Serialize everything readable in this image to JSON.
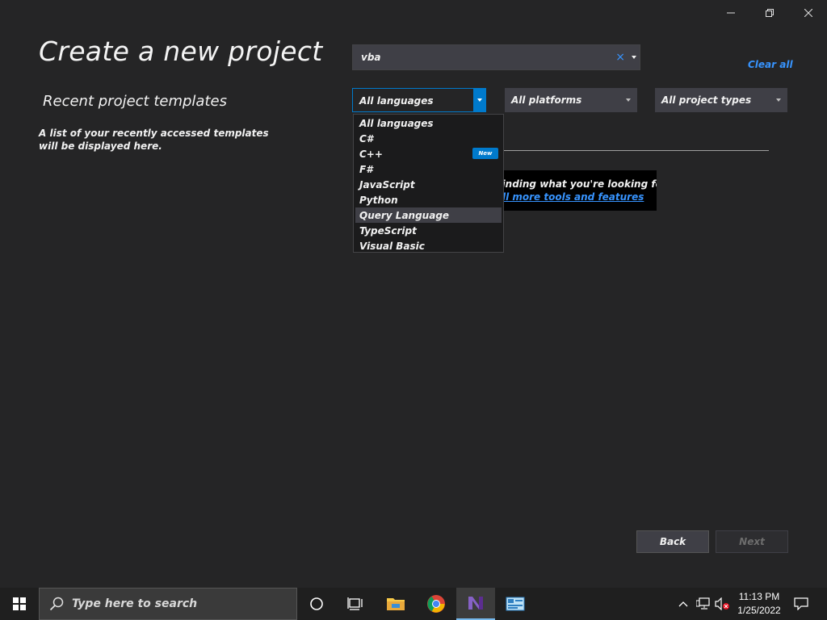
{
  "window": {
    "controls": [
      "minimize-icon",
      "restore-icon",
      "close-icon"
    ]
  },
  "page": {
    "title": "Create a new project",
    "recent_heading": "Recent project templates",
    "recent_description": "A list of your recently accessed templates will be displayed here."
  },
  "search": {
    "value": "vba",
    "clear_glyph": "×"
  },
  "clear_all_label": "Clear all",
  "filters": {
    "language": "All languages",
    "platform": "All platforms",
    "project_type": "All project types"
  },
  "language_dropdown": {
    "items": [
      "All languages",
      "C#",
      "C++",
      "F#",
      "JavaScript",
      "Python",
      "Query Language",
      "TypeScript",
      "Visual Basic"
    ],
    "highlighted": "Query Language",
    "badge_item": "C++",
    "badge_label": "New"
  },
  "hint": {
    "question": "Not finding what you're looking for?",
    "link": "Install more tools and features"
  },
  "buttons": {
    "back": "Back",
    "next": "Next"
  },
  "taskbar": {
    "search_placeholder": "Type here to search",
    "pinned": [
      "cortana-icon",
      "task-view-icon",
      "file-explorer-icon",
      "chrome-icon",
      "visual-studio-icon",
      "control-panel-icon"
    ],
    "time": "11:13 PM",
    "date": "1/25/2022"
  },
  "colors": {
    "background": "#252526",
    "accent": "#007acc",
    "link": "#3794ff"
  }
}
